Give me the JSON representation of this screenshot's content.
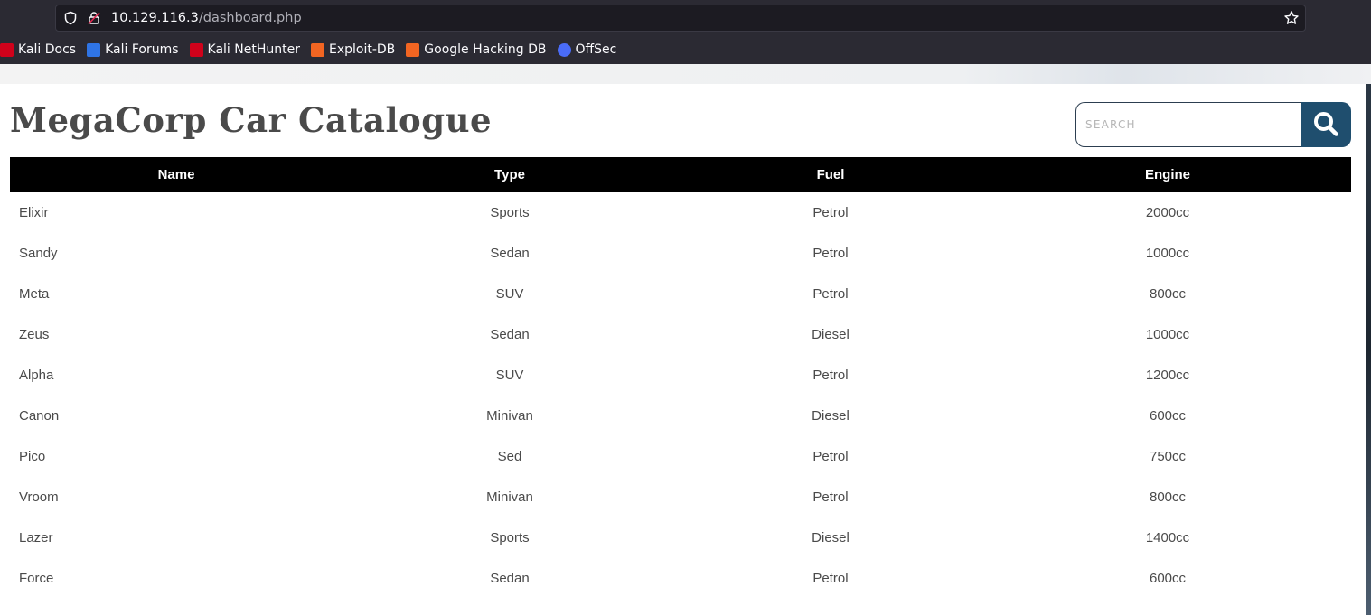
{
  "browser": {
    "url_host": "10.129.116.3",
    "url_path": "/dashboard.php",
    "bookmarks": [
      {
        "label": "Kali Docs",
        "icon": "kali-docs-icon",
        "color": "#d0021b"
      },
      {
        "label": "Kali Forums",
        "icon": "kali-forums-icon",
        "color": "#2f74e6"
      },
      {
        "label": "Kali NetHunter",
        "icon": "kali-nethunter-icon",
        "color": "#d0021b"
      },
      {
        "label": "Exploit-DB",
        "icon": "exploit-db-icon",
        "color": "#f26522"
      },
      {
        "label": "Google Hacking DB",
        "icon": "ghdb-icon",
        "color": "#f26522"
      },
      {
        "label": "OffSec",
        "icon": "offsec-icon",
        "color": "#4a6cf7"
      }
    ]
  },
  "page": {
    "title": "MegaCorp Car Catalogue",
    "search": {
      "placeholder": "SEARCH",
      "value": ""
    },
    "table": {
      "headers": [
        "Name",
        "Type",
        "Fuel",
        "Engine"
      ],
      "rows": [
        [
          "Elixir",
          "Sports",
          "Petrol",
          "2000cc"
        ],
        [
          "Sandy",
          "Sedan",
          "Petrol",
          "1000cc"
        ],
        [
          "Meta",
          "SUV",
          "Petrol",
          "800cc"
        ],
        [
          "Zeus",
          "Sedan",
          "Diesel",
          "1000cc"
        ],
        [
          "Alpha",
          "SUV",
          "Petrol",
          "1200cc"
        ],
        [
          "Canon",
          "Minivan",
          "Diesel",
          "600cc"
        ],
        [
          "Pico",
          "Sed",
          "Petrol",
          "750cc"
        ],
        [
          "Vroom",
          "Minivan",
          "Petrol",
          "800cc"
        ],
        [
          "Lazer",
          "Sports",
          "Diesel",
          "1400cc"
        ],
        [
          "Force",
          "Sedan",
          "Petrol",
          "600cc"
        ]
      ]
    }
  },
  "colors": {
    "header_bg": "#000000",
    "search_button": "#1f4e6e",
    "title_text": "#4a4a4a"
  }
}
